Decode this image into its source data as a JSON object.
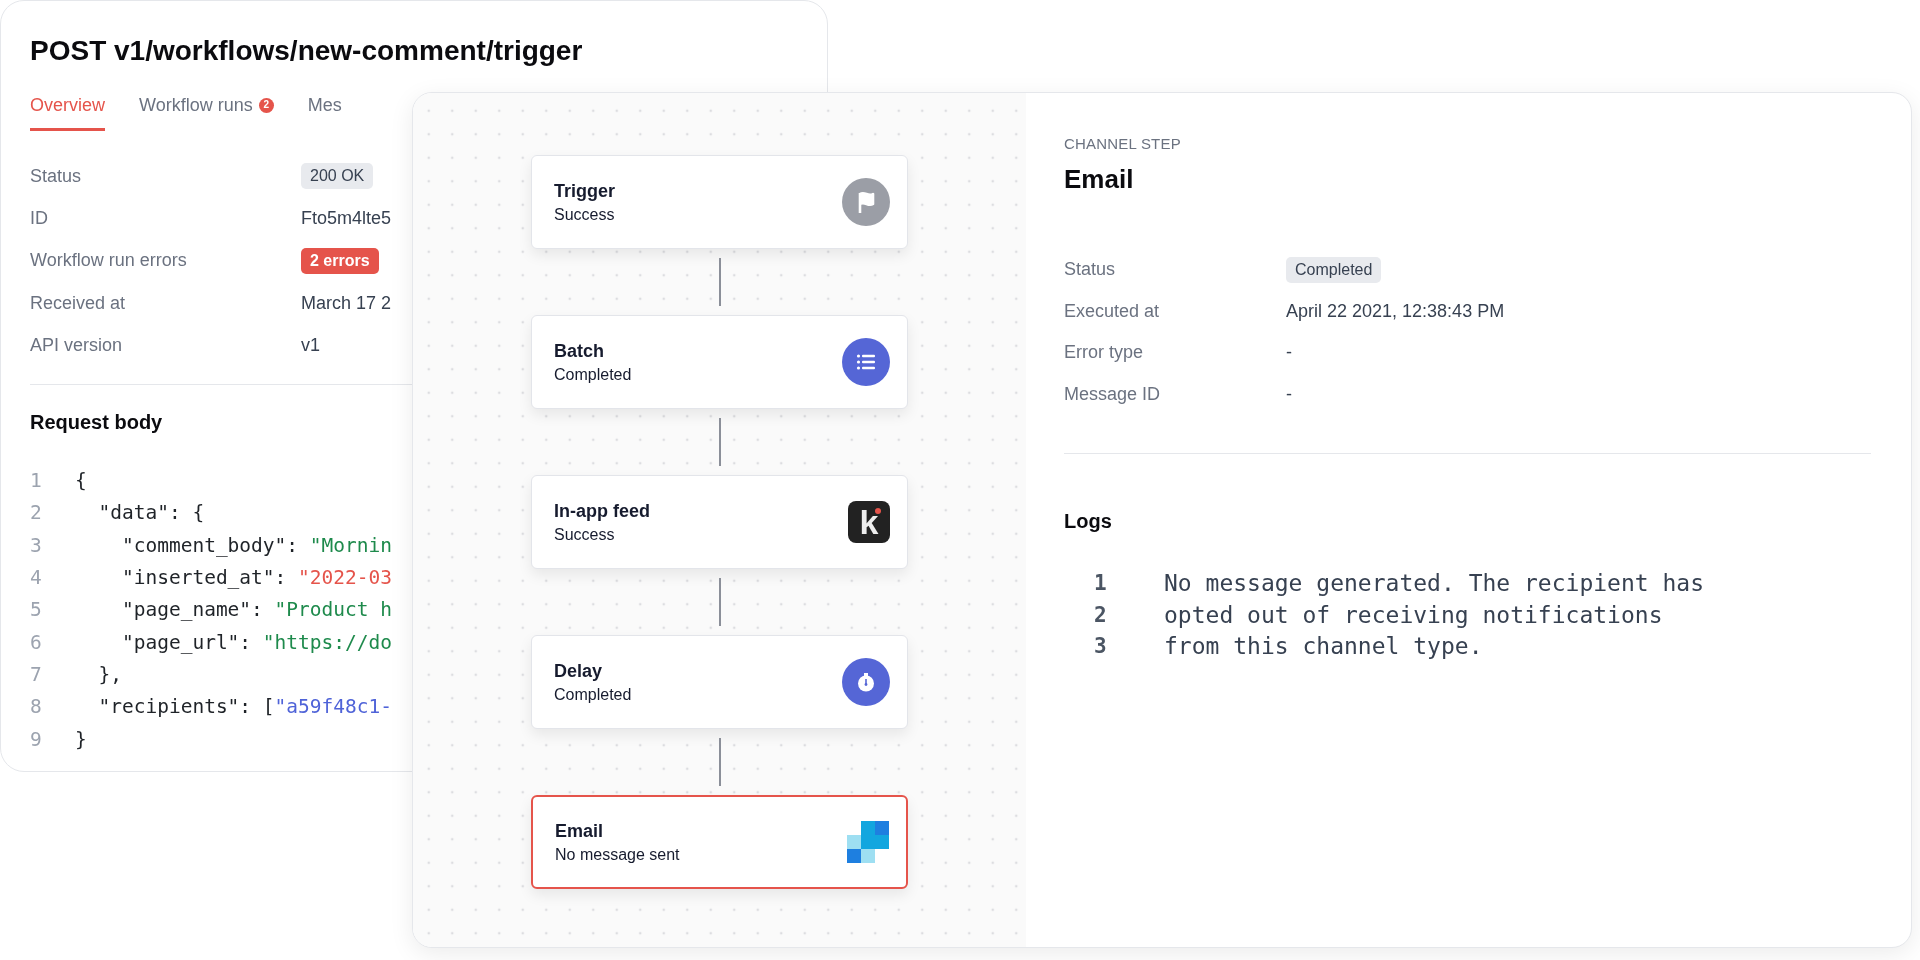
{
  "request": {
    "title": "POST v1/workflows/new-comment/trigger",
    "tabs": [
      {
        "label": "Overview",
        "selected": true
      },
      {
        "label": "Workflow runs",
        "selected": false,
        "badge": "2"
      },
      {
        "label": "Mes",
        "selected": false
      }
    ],
    "fields": [
      {
        "label": "Status",
        "value": "200 OK",
        "kind": "badge"
      },
      {
        "label": "ID",
        "value": "Fto5m4lte5",
        "kind": "text"
      },
      {
        "label": "Workflow run errors",
        "value": "2 errors",
        "kind": "error"
      },
      {
        "label": "Received at",
        "value": "March 17 2",
        "kind": "text"
      },
      {
        "label": "API version",
        "value": "v1",
        "kind": "text"
      }
    ],
    "body_title": "Request body",
    "code": [
      {
        "number": "1",
        "tokens": [
          {
            "kind": "plain",
            "text": "{"
          }
        ]
      },
      {
        "number": "2",
        "tokens": [
          {
            "kind": "plain",
            "text": "  \"data\": {"
          }
        ]
      },
      {
        "number": "3",
        "tokens": [
          {
            "kind": "plain",
            "text": "    \"comment_body\": "
          },
          {
            "kind": "string",
            "text": "\"Mornin"
          }
        ]
      },
      {
        "number": "4",
        "tokens": [
          {
            "kind": "plain",
            "text": "    \"inserted_at\": "
          },
          {
            "kind": "date",
            "text": "\"2022-03"
          }
        ]
      },
      {
        "number": "5",
        "tokens": [
          {
            "kind": "plain",
            "text": "    \"page_name\": "
          },
          {
            "kind": "string",
            "text": "\"Product h"
          }
        ]
      },
      {
        "number": "6",
        "tokens": [
          {
            "kind": "plain",
            "text": "    \"page_url\": "
          },
          {
            "kind": "string",
            "text": "\"https://do"
          }
        ]
      },
      {
        "number": "7",
        "tokens": [
          {
            "kind": "plain",
            "text": "  },"
          }
        ]
      },
      {
        "number": "8",
        "tokens": [
          {
            "kind": "plain",
            "text": "  \"recipients\": ["
          },
          {
            "kind": "id",
            "text": "\"a59f48c1-"
          }
        ]
      },
      {
        "number": "9",
        "tokens": [
          {
            "kind": "plain",
            "text": "}"
          }
        ]
      }
    ]
  },
  "workflow": {
    "nodes": [
      {
        "title": "Trigger",
        "status": "Success",
        "kind": "flag",
        "error": false
      },
      {
        "title": "Batch",
        "status": "Completed",
        "kind": "list",
        "error": false
      },
      {
        "title": "In-app feed",
        "status": "Success",
        "kind": "letter",
        "letter": "k",
        "error": false
      },
      {
        "title": "Delay",
        "status": "Completed",
        "kind": "timer",
        "error": false
      },
      {
        "title": "Email",
        "status": "No message sent",
        "kind": "squares",
        "error": true
      }
    ]
  },
  "step": {
    "eyebrow": "CHANNEL STEP",
    "title": "Email",
    "fields": [
      {
        "label": "Status",
        "value": "Completed",
        "kind": "badge"
      },
      {
        "label": "Executed at",
        "value": "April 22 2021, 12:38:43 PM",
        "kind": "text"
      },
      {
        "label": "Error type",
        "value": "-",
        "kind": "text"
      },
      {
        "label": "Message ID",
        "value": "-",
        "kind": "text"
      }
    ],
    "logs_title": "Logs",
    "logs": [
      {
        "number": "1",
        "text": "No message generated. The recipient has"
      },
      {
        "number": "2",
        "text": "opted out of receiving notifications"
      },
      {
        "number": "3",
        "text": "from this channel type."
      }
    ]
  }
}
